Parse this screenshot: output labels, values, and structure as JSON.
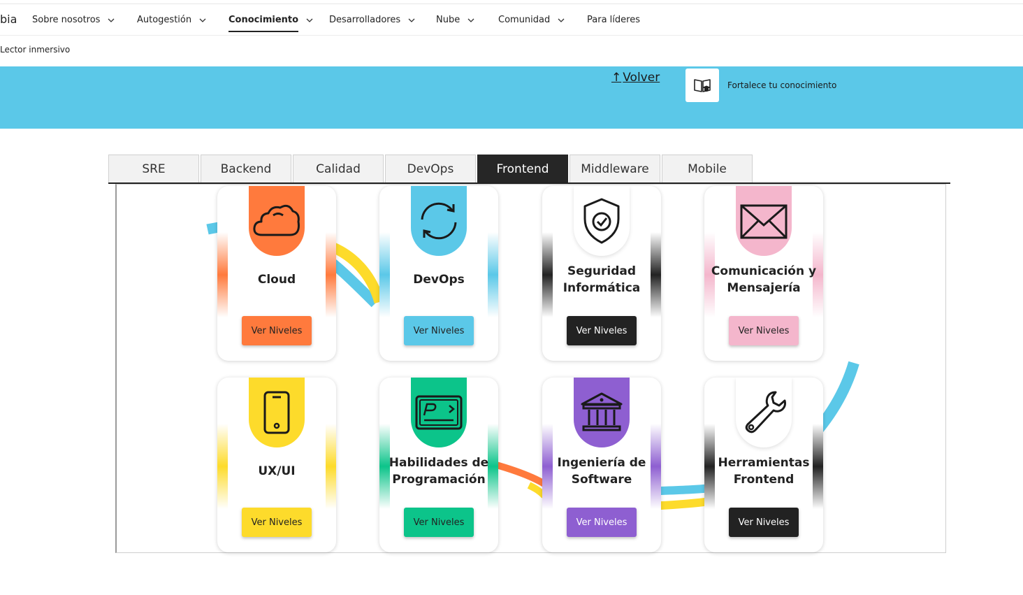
{
  "nav": {
    "brand_fragment": "bia",
    "items": [
      {
        "label": "Sobre nosotros",
        "has_menu": true
      },
      {
        "label": "Autogestión",
        "has_menu": true
      },
      {
        "label": "Conocimiento",
        "has_menu": true,
        "active": true
      },
      {
        "label": "Desarrolladores",
        "has_menu": true
      },
      {
        "label": "Nube",
        "has_menu": true
      },
      {
        "label": "Comunidad",
        "has_menu": true
      },
      {
        "label": "Para líderes",
        "has_menu": false
      }
    ]
  },
  "reader": {
    "label": "Lector inmersivo"
  },
  "banner": {
    "back_arrow": "↑",
    "back_label": "Volver",
    "strength_label": "Fortalece tu conocimiento",
    "strength_icon": "book-graduation-icon"
  },
  "tabs": [
    {
      "label": "SRE"
    },
    {
      "label": "Backend"
    },
    {
      "label": "Calidad"
    },
    {
      "label": "DevOps"
    },
    {
      "label": "Frontend",
      "active": true
    },
    {
      "label": "Middleware"
    },
    {
      "label": "Mobile"
    }
  ],
  "cards": [
    {
      "title": "Cloud",
      "button": "Ver Niveles",
      "icon": "cloud-icon",
      "color": "#ff7a3d",
      "button_text_color": "#222222"
    },
    {
      "title": "DevOps",
      "button": "Ver Niveles",
      "icon": "refresh-icon",
      "color": "#5bc8e8",
      "button_text_color": "#222222"
    },
    {
      "title": "Seguridad Informática",
      "button": "Ver Niveles",
      "icon": "shield-check-icon",
      "color": "#222222",
      "button_text_color": "#ffffff",
      "light_tag": true
    },
    {
      "title": "Comunicación y Mensajería",
      "button": "Ver Niveles",
      "icon": "envelope-icon",
      "color": "#f4b6cc",
      "button_text_color": "#222222"
    },
    {
      "title": "UX/UI",
      "button": "Ver Niveles",
      "icon": "smartphone-icon",
      "color": "#fddb2b",
      "button_text_color": "#222222"
    },
    {
      "title": "Habilidades de Programación",
      "button": "Ver Niveles",
      "icon": "code-card-icon",
      "color": "#0cc48a",
      "button_text_color": "#222222"
    },
    {
      "title": "Ingeniería de Software",
      "button": "Ver Niveles",
      "icon": "bank-building-icon",
      "color": "#8e5fd1",
      "button_text_color": "#ffffff"
    },
    {
      "title": "Herramientas Frontend",
      "button": "Ver Niveles",
      "icon": "wrench-icon",
      "color": "#222222",
      "button_text_color": "#ffffff",
      "light_tag": true
    }
  ]
}
